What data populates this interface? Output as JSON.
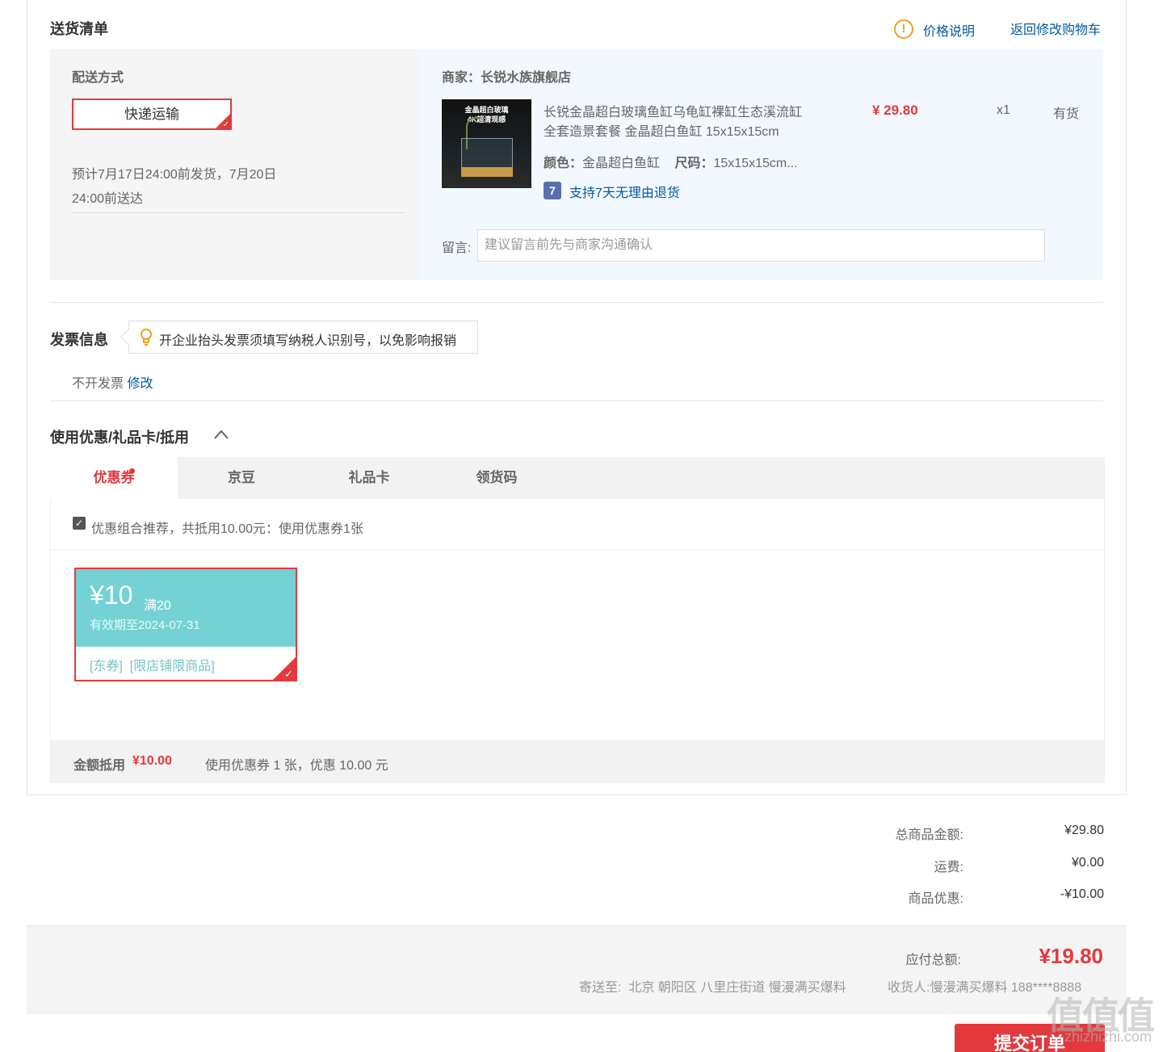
{
  "colors": {
    "accent": "#e4393c",
    "link": "#005aa0",
    "coupon": "#74d2d4"
  },
  "delivery": {
    "title": "送货清单",
    "price_note": "价格说明",
    "back_to_cart": "返回修改购物车",
    "ship_method_label": "配送方式",
    "ship_method": "快递运输",
    "estimate_line1": "预计7月17日24:00前发货，7月20日",
    "estimate_line2": "24:00前送达"
  },
  "merchant": {
    "label": "商家：",
    "name": "长锐水族旗舰店",
    "product": {
      "image_text1": "金晶超白玻璃",
      "image_text2": "4K超清观感",
      "title_line1": "长锐金晶超白玻璃鱼缸乌龟缸裸缸生态溪流缸",
      "title_line2": "全套造景套餐 金晶超白鱼缸 15x15x15cm",
      "price": "¥ 29.80",
      "qty": "x1",
      "stock": "有货",
      "color_label": "颜色：",
      "color_value": "金晶超白鱼缸",
      "size_label": "尺码：",
      "size_value": "15x15x15cm...",
      "return_badge": "7",
      "return_policy": "支持7天无理由退货"
    },
    "remark_label": "留言:",
    "remark_placeholder": "建议留言前先与商家沟通确认"
  },
  "invoice": {
    "title": "发票信息",
    "tip": "开企业抬头发票须填写纳税人识别号，以免影响报销",
    "status": "不开发票",
    "edit": "修改"
  },
  "discount": {
    "title": "使用优惠/礼品卡/抵用",
    "tabs": [
      "优惠券",
      "京豆",
      "礼品卡",
      "领货码"
    ],
    "combo_text": "优惠组合推荐，共抵用10.00元：使用优惠券1张",
    "coupon": {
      "amount": "¥10",
      "threshold": "满20",
      "valid": "有效期至2024-07-31",
      "tags": "[东券]  [限店铺限商品]"
    },
    "summary_label": "金额抵用",
    "summary_amount": "¥10.00",
    "summary_text": "使用优惠券 1 张，优惠 10.00 元"
  },
  "totals": {
    "goods_label": "总商品金额:",
    "goods_value": "¥29.80",
    "freight_label": "运费:",
    "freight_value": "¥0.00",
    "discount_label": "商品优惠:",
    "discount_value": "-¥10.00"
  },
  "pay": {
    "total_label": "应付总额:",
    "total_value": "¥19.80",
    "address_label": "寄送至:",
    "address": "北京 朝阳区 八里庄街道 慢漫满买爆料",
    "receiver_label": "收货人:",
    "receiver": "慢漫满买爆料 188****8888"
  },
  "submit": {
    "label": "提交订单"
  },
  "watermark": {
    "logo": "值值值",
    "url": "zhizhizhi.com"
  }
}
